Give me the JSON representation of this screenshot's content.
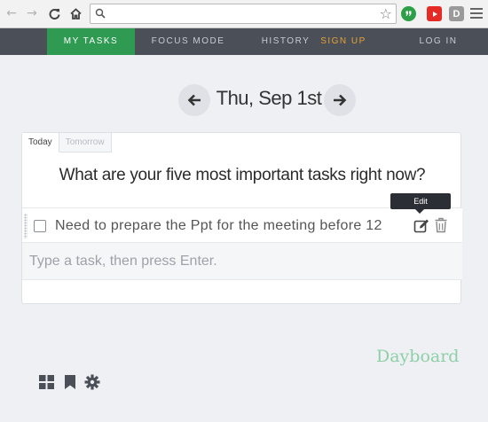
{
  "browser": {
    "address_value": "",
    "extensions": [
      "hangouts-extension",
      "youtube-extension",
      "d-extension"
    ],
    "ext_d_label": "D"
  },
  "nav": {
    "my_tasks": "MY TASKS",
    "focus_mode": "FOCUS MODE",
    "history": "HISTORY",
    "sign_up": "SIGN UP",
    "log_in": "LOG IN"
  },
  "date": {
    "label": "Thu, Sep 1st"
  },
  "tabs": {
    "today": "Today",
    "tomorrow": "Tomorrow"
  },
  "question": "What are your five most important tasks right now?",
  "tasks": [
    {
      "text": "Need to prepare the Ppt for the meeting before 12",
      "done": false
    }
  ],
  "tooltip": "Edit",
  "new_task": {
    "placeholder": "Type a task, then press Enter."
  },
  "brand": "Dayboard",
  "colors": {
    "nav_bg": "#4a4f58",
    "active_tab": "#2e9a52",
    "sign_up": "#e8a235",
    "brand": "#8fcfa8"
  }
}
